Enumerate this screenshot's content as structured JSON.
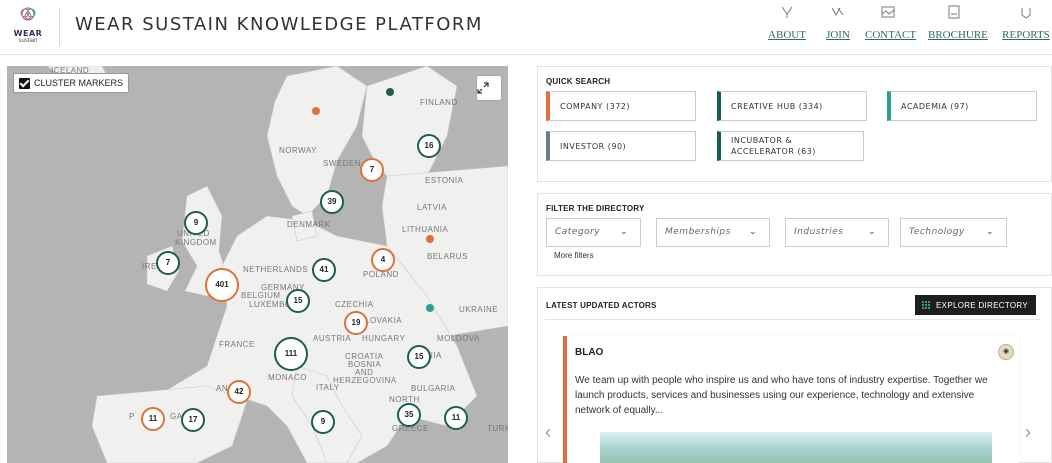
{
  "header": {
    "logo_word": "WEAR",
    "logo_sub": "sustain",
    "title": "WEAR SUSTAIN KNOWLEDGE PLATFORM",
    "nav": [
      {
        "label": "ABOUT",
        "icon": "about-icon"
      },
      {
        "label": "JOIN",
        "icon": "join-icon"
      },
      {
        "label": "CONTACT",
        "icon": "contact-icon"
      },
      {
        "label": "BROCHURE",
        "icon": "brochure-icon"
      },
      {
        "label": "REPORTS",
        "icon": "reports-icon"
      }
    ]
  },
  "map": {
    "cluster_toggle_label": "CLUSTER MARKERS",
    "cluster_toggle_checked": true,
    "labels": {
      "iceland": "ICELAND",
      "finland": "FINLAND",
      "norway": "NORWAY",
      "sweden": "SWEDEN",
      "estonia": "ESTONIA",
      "latvia": "LATVIA",
      "denmark": "DENMARK",
      "lithuania": "LITHUANIA",
      "united": "UNITED",
      "kingdom": "KINGDOM",
      "ireland": "IREL",
      "belarus": "BELARUS",
      "netherlands": "NETHERLANDS",
      "poland": "POLAND",
      "germany": "GERMANY",
      "belgium": "BELGIUM",
      "luxembourg": "LUXEMBO",
      "czechia": "CZECHIA",
      "ukraine": "UKRAINE",
      "slovakia": "LOVAKIA",
      "austria": "AUSTRIA",
      "hungary": "HUNGARY",
      "moldova": "MOLDOVA",
      "france": "FRANCE",
      "croatia": "CROATIA",
      "bosnia": "BOSNIA",
      "and": "AND",
      "herzegovina": "HERZEGOVINA",
      "romania": "NIA",
      "monaco": "MONACO",
      "italy": "ITALY",
      "bulgaria": "BULGARIA",
      "north": "NORTH",
      "greece": "GREECE",
      "andorra": "AN",
      "portugal": "P",
      "spain_gal": "GAL",
      "turkey": "TURK"
    },
    "markers": [
      {
        "id": "norway-16",
        "count": "16",
        "color": "teal"
      },
      {
        "id": "sweden-7",
        "count": "7",
        "color": "orange"
      },
      {
        "id": "denmark-39",
        "count": "39",
        "color": "teal"
      },
      {
        "id": "uk-9",
        "count": "9",
        "color": "teal"
      },
      {
        "id": "ireland-7",
        "count": "7",
        "color": "teal"
      },
      {
        "id": "netherlands-41",
        "count": "41",
        "color": "teal"
      },
      {
        "id": "poland-4",
        "count": "4",
        "color": "orange"
      },
      {
        "id": "london-401",
        "count": "401",
        "color": "orange"
      },
      {
        "id": "belgium-15",
        "count": "15",
        "color": "teal"
      },
      {
        "id": "czechia-19",
        "count": "19",
        "color": "orange"
      },
      {
        "id": "france-111",
        "count": "111",
        "color": "teal"
      },
      {
        "id": "romania-15",
        "count": "15",
        "color": "teal"
      },
      {
        "id": "spain-42",
        "count": "42",
        "color": "orange"
      },
      {
        "id": "portugal-11",
        "count": "11",
        "color": "orange"
      },
      {
        "id": "spain-17",
        "count": "17",
        "color": "teal"
      },
      {
        "id": "italy-9",
        "count": "9",
        "color": "teal"
      },
      {
        "id": "greece-35",
        "count": "35",
        "color": "teal"
      },
      {
        "id": "turkey-11",
        "count": "11",
        "color": "teal"
      }
    ]
  },
  "quick_search": {
    "title": "QUICK SEARCH",
    "buttons": [
      {
        "label": "COMPANY (372)",
        "kind": "company"
      },
      {
        "label": "CREATIVE HUB (334)",
        "kind": "creative"
      },
      {
        "label": "ACADEMIA (97)",
        "kind": "academia"
      },
      {
        "label": "INVESTOR (90)",
        "kind": "investor"
      },
      {
        "label": "INCUBATOR & ACCELERATOR (63)",
        "kind": "creative"
      }
    ]
  },
  "filter": {
    "title": "FILTER THE DIRECTORY",
    "selects": [
      "Category",
      "Memberships",
      "Industries",
      "Technology"
    ],
    "more_filters": "More filters"
  },
  "latest": {
    "title": "LATEST UPDATED ACTORS",
    "explore_label": "EXPLORE DIRECTORY",
    "card": {
      "name": "BLAO",
      "text": "We team up with people who inspire us and who have tons of industry expertise. Together we launch products, services and businesses using our experience, technology and extensive network of equally..."
    }
  },
  "colors": {
    "teal": "#1d5c55",
    "orange": "#e0703a",
    "accent_green": "#2aa18e",
    "nav_link": "#2d6c63"
  }
}
